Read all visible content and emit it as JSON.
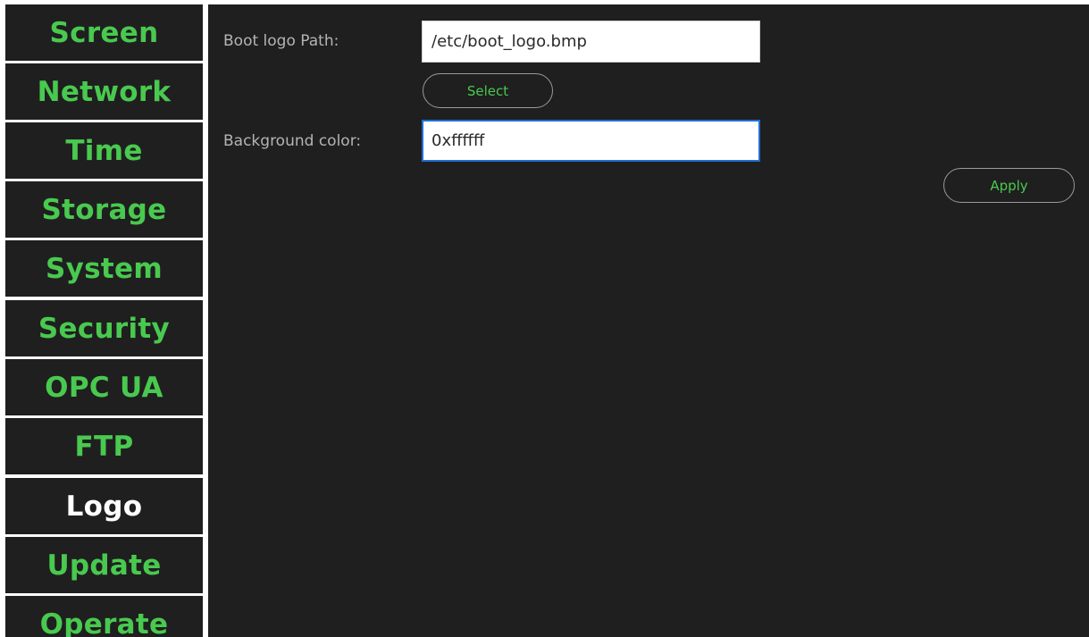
{
  "sidebar": {
    "items": [
      {
        "label": "Screen",
        "active": false
      },
      {
        "label": "Network",
        "active": false
      },
      {
        "label": "Time",
        "active": false
      },
      {
        "label": "Storage",
        "active": false
      },
      {
        "label": "System",
        "active": false
      },
      {
        "label": "Security",
        "active": false
      },
      {
        "label": "OPC UA",
        "active": false
      },
      {
        "label": "FTP",
        "active": false
      },
      {
        "label": "Logo",
        "active": true
      },
      {
        "label": "Update",
        "active": false
      },
      {
        "label": "Operate",
        "active": false
      }
    ]
  },
  "logo_settings": {
    "boot_logo_label": "Boot logo Path:",
    "boot_logo_value": "/etc/boot_logo.bmp",
    "select_label": "Select",
    "background_color_label": "Background color:",
    "background_color_value": "0xffffff",
    "apply_label": "Apply"
  },
  "colors": {
    "accent_green": "#49c94f",
    "panel_background": "#1f1f1f",
    "active_text": "#ffffff",
    "focus_border": "#1f6fd0"
  }
}
